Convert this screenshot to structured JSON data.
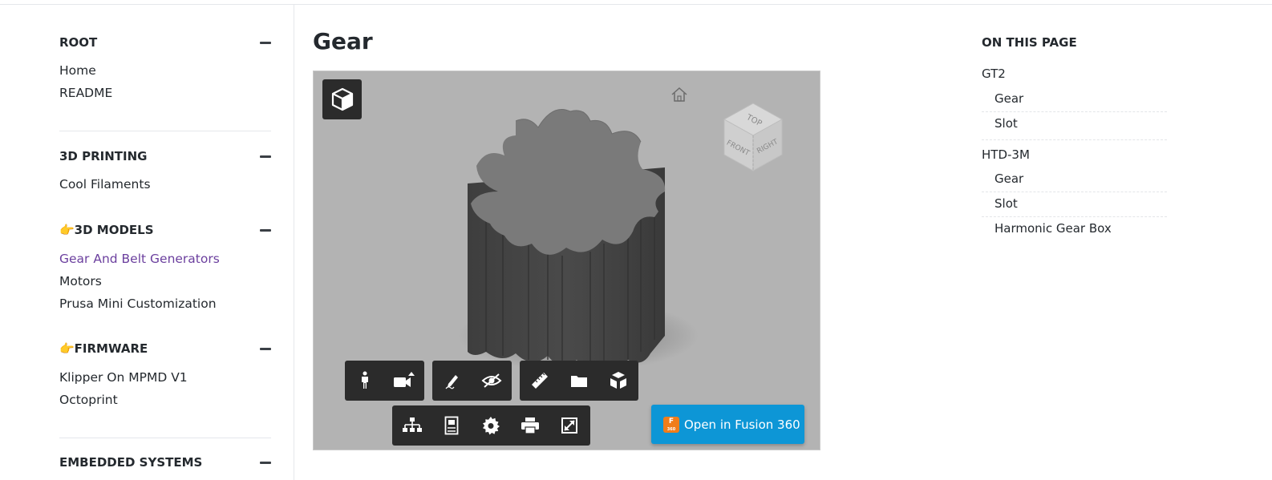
{
  "sidebar": {
    "sections": [
      {
        "title": "ROOT",
        "items": [
          "Home",
          "README"
        ]
      },
      {
        "title": "3D PRINTING",
        "items": [
          "Cool Filaments"
        ]
      },
      {
        "title": "👉3D MODELS",
        "items": [
          "Gear And Belt Generators",
          "Motors",
          "Prusa Mini Customization"
        ]
      },
      {
        "title": "👉FIRMWARE",
        "items": [
          "Klipper On MPMD V1",
          "Octoprint"
        ]
      },
      {
        "title": "EMBEDDED SYSTEMS",
        "items": []
      }
    ],
    "active_item": "Gear And Belt Generators"
  },
  "main": {
    "title": "Gear",
    "viewer": {
      "viewcube_faces": {
        "top": "TOP",
        "front": "FRONT",
        "right": "RIGHT"
      },
      "toolbar_row1": [
        [
          "person-icon",
          "camera-icon"
        ],
        [
          "pencil-icon",
          "hide-icon"
        ],
        [
          "ruler-icon",
          "folder-icon",
          "explode-icon"
        ]
      ],
      "toolbar_row2": [
        "tree-icon",
        "settings-panel-icon",
        "gear-icon",
        "print-icon",
        "fullscreen-icon"
      ],
      "open_button": "Open in Fusion 360",
      "fusion_logo_letter": "F",
      "fusion_logo_sub": "360"
    }
  },
  "toc": {
    "title": "ON THIS PAGE",
    "items": [
      {
        "label": "GT2",
        "level": 1
      },
      {
        "label": "Gear",
        "level": 2
      },
      {
        "label": "Slot",
        "level": 2
      },
      {
        "label": "HTD-3M",
        "level": 1
      },
      {
        "label": "Gear",
        "level": 2
      },
      {
        "label": "Slot",
        "level": 2
      },
      {
        "label": "Harmonic Gear Box",
        "level": 2
      }
    ]
  },
  "colors": {
    "active_link": "#6b3f9e",
    "fusion_button": "#0d96d6",
    "viewer_bg": "#b3b3b3",
    "toolbar_bg": "#2b2b2b"
  }
}
